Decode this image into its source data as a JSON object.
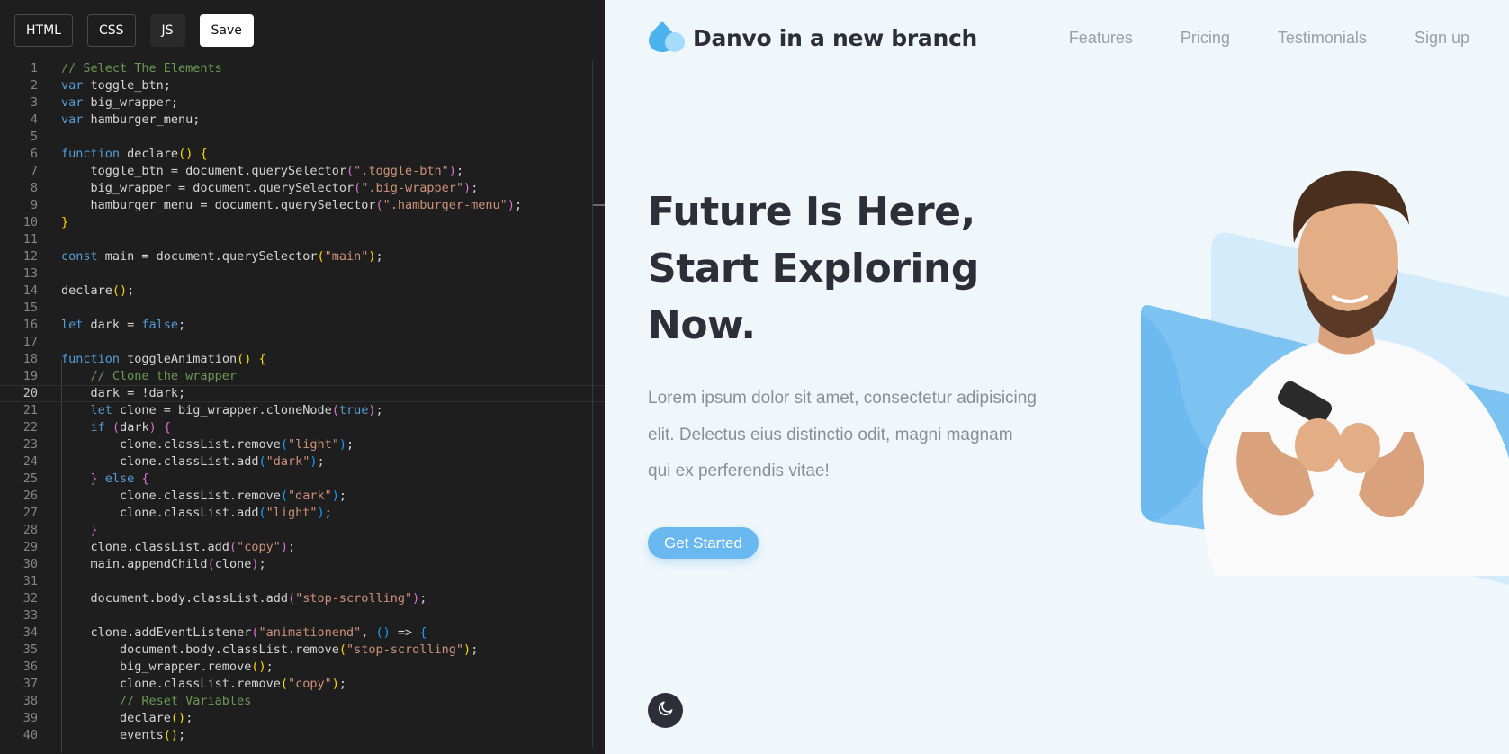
{
  "editor": {
    "tabs": [
      {
        "label": "HTML"
      },
      {
        "label": "CSS"
      },
      {
        "label": "JS"
      }
    ],
    "save_label": "Save",
    "active_tab": "JS",
    "current_line": 20,
    "colors": {
      "keyword": "#569cd6",
      "comment": "#6a9955",
      "string": "#ce9178",
      "bracket_1": "#ffd700",
      "bracket_2": "#da70d6",
      "bracket_3": "#179fff"
    },
    "lines": [
      {
        "n": "1",
        "tokens": [
          [
            "c",
            "// Select The Elements"
          ]
        ]
      },
      {
        "n": "2",
        "tokens": [
          [
            "k",
            "var"
          ],
          [
            "t",
            " toggle_btn;"
          ]
        ]
      },
      {
        "n": "3",
        "tokens": [
          [
            "k",
            "var"
          ],
          [
            "t",
            " big_wrapper;"
          ]
        ]
      },
      {
        "n": "4",
        "tokens": [
          [
            "k",
            "var"
          ],
          [
            "t",
            " hamburger_menu;"
          ]
        ]
      },
      {
        "n": "5",
        "tokens": []
      },
      {
        "n": "6",
        "tokens": [
          [
            "k",
            "function"
          ],
          [
            "t",
            " declare"
          ],
          [
            "p1",
            "()"
          ],
          [
            "t",
            " "
          ],
          [
            "p1",
            "{"
          ]
        ]
      },
      {
        "n": "7",
        "tokens": [
          [
            "t",
            "    toggle_btn = document.querySelector"
          ],
          [
            "p2",
            "("
          ],
          [
            "s",
            "\".toggle-btn\""
          ],
          [
            "p2",
            ")"
          ],
          [
            "t",
            ";"
          ]
        ]
      },
      {
        "n": "8",
        "tokens": [
          [
            "t",
            "    big_wrapper = document.querySelector"
          ],
          [
            "p2",
            "("
          ],
          [
            "s",
            "\".big-wrapper\""
          ],
          [
            "p2",
            ")"
          ],
          [
            "t",
            ";"
          ]
        ]
      },
      {
        "n": "9",
        "tokens": [
          [
            "t",
            "    hamburger_menu = document.querySelector"
          ],
          [
            "p2",
            "("
          ],
          [
            "s",
            "\".hamburger-menu\""
          ],
          [
            "p2",
            ")"
          ],
          [
            "t",
            ";"
          ]
        ]
      },
      {
        "n": "10",
        "tokens": [
          [
            "p1",
            "}"
          ]
        ]
      },
      {
        "n": "11",
        "tokens": []
      },
      {
        "n": "12",
        "tokens": [
          [
            "k",
            "const"
          ],
          [
            "t",
            " main = document.querySelector"
          ],
          [
            "p1",
            "("
          ],
          [
            "s",
            "\"main\""
          ],
          [
            "p1",
            ")"
          ],
          [
            "t",
            ";"
          ]
        ]
      },
      {
        "n": "13",
        "tokens": []
      },
      {
        "n": "14",
        "tokens": [
          [
            "t",
            "declare"
          ],
          [
            "p1",
            "()"
          ],
          [
            "t",
            ";"
          ]
        ]
      },
      {
        "n": "15",
        "tokens": []
      },
      {
        "n": "16",
        "tokens": [
          [
            "k",
            "let"
          ],
          [
            "t",
            " dark = "
          ],
          [
            "k",
            "false"
          ],
          [
            "t",
            ";"
          ]
        ]
      },
      {
        "n": "17",
        "tokens": []
      },
      {
        "n": "18",
        "tokens": [
          [
            "k",
            "function"
          ],
          [
            "t",
            " toggleAnimation"
          ],
          [
            "p1",
            "()"
          ],
          [
            "t",
            " "
          ],
          [
            "p1",
            "{"
          ]
        ]
      },
      {
        "n": "19",
        "tokens": [
          [
            "c",
            "    // Clone the wrapper"
          ]
        ]
      },
      {
        "n": "20",
        "tokens": [
          [
            "t",
            "    dark = !dark;"
          ]
        ]
      },
      {
        "n": "21",
        "tokens": [
          [
            "t",
            "    "
          ],
          [
            "k",
            "let"
          ],
          [
            "t",
            " clone = big_wrapper.cloneNode"
          ],
          [
            "p2",
            "("
          ],
          [
            "k",
            "true"
          ],
          [
            "p2",
            ")"
          ],
          [
            "t",
            ";"
          ]
        ]
      },
      {
        "n": "22",
        "tokens": [
          [
            "t",
            "    "
          ],
          [
            "k",
            "if"
          ],
          [
            "t",
            " "
          ],
          [
            "p2",
            "("
          ],
          [
            "t",
            "dark"
          ],
          [
            "p2",
            ")"
          ],
          [
            "t",
            " "
          ],
          [
            "p2",
            "{"
          ]
        ]
      },
      {
        "n": "23",
        "tokens": [
          [
            "t",
            "        clone.classList.remove"
          ],
          [
            "p3",
            "("
          ],
          [
            "s",
            "\"light\""
          ],
          [
            "p3",
            ")"
          ],
          [
            "t",
            ";"
          ]
        ]
      },
      {
        "n": "24",
        "tokens": [
          [
            "t",
            "        clone.classList.add"
          ],
          [
            "p3",
            "("
          ],
          [
            "s",
            "\"dark\""
          ],
          [
            "p3",
            ")"
          ],
          [
            "t",
            ";"
          ]
        ]
      },
      {
        "n": "25",
        "tokens": [
          [
            "t",
            "    "
          ],
          [
            "p2",
            "}"
          ],
          [
            "t",
            " "
          ],
          [
            "k",
            "else"
          ],
          [
            "t",
            " "
          ],
          [
            "p2",
            "{"
          ]
        ]
      },
      {
        "n": "26",
        "tokens": [
          [
            "t",
            "        clone.classList.remove"
          ],
          [
            "p3",
            "("
          ],
          [
            "s",
            "\"dark\""
          ],
          [
            "p3",
            ")"
          ],
          [
            "t",
            ";"
          ]
        ]
      },
      {
        "n": "27",
        "tokens": [
          [
            "t",
            "        clone.classList.add"
          ],
          [
            "p3",
            "("
          ],
          [
            "s",
            "\"light\""
          ],
          [
            "p3",
            ")"
          ],
          [
            "t",
            ";"
          ]
        ]
      },
      {
        "n": "28",
        "tokens": [
          [
            "t",
            "    "
          ],
          [
            "p2",
            "}"
          ]
        ]
      },
      {
        "n": "29",
        "tokens": [
          [
            "t",
            "    clone.classList.add"
          ],
          [
            "p2",
            "("
          ],
          [
            "s",
            "\"copy\""
          ],
          [
            "p2",
            ")"
          ],
          [
            "t",
            ";"
          ]
        ]
      },
      {
        "n": "30",
        "tokens": [
          [
            "t",
            "    main.appendChild"
          ],
          [
            "p2",
            "("
          ],
          [
            "t",
            "clone"
          ],
          [
            "p2",
            ")"
          ],
          [
            "t",
            ";"
          ]
        ]
      },
      {
        "n": "31",
        "tokens": []
      },
      {
        "n": "32",
        "tokens": [
          [
            "t",
            "    document.body.classList.add"
          ],
          [
            "p2",
            "("
          ],
          [
            "s",
            "\"stop-scrolling\""
          ],
          [
            "p2",
            ")"
          ],
          [
            "t",
            ";"
          ]
        ]
      },
      {
        "n": "33",
        "tokens": []
      },
      {
        "n": "34",
        "tokens": [
          [
            "t",
            "    clone.addEventListener"
          ],
          [
            "p2",
            "("
          ],
          [
            "s",
            "\"animationend\""
          ],
          [
            "t",
            ", "
          ],
          [
            "p3",
            "()"
          ],
          [
            "t",
            " => "
          ],
          [
            "p3",
            "{"
          ]
        ]
      },
      {
        "n": "35",
        "tokens": [
          [
            "t",
            "        document.body.classList.remove"
          ],
          [
            "p1",
            "("
          ],
          [
            "s",
            "\"stop-scrolling\""
          ],
          [
            "p1",
            ")"
          ],
          [
            "t",
            ";"
          ]
        ]
      },
      {
        "n": "36",
        "tokens": [
          [
            "t",
            "        big_wrapper.remove"
          ],
          [
            "p1",
            "()"
          ],
          [
            "t",
            ";"
          ]
        ]
      },
      {
        "n": "37",
        "tokens": [
          [
            "t",
            "        clone.classList.remove"
          ],
          [
            "p1",
            "("
          ],
          [
            "s",
            "\"copy\""
          ],
          [
            "p1",
            ")"
          ],
          [
            "t",
            ";"
          ]
        ]
      },
      {
        "n": "38",
        "tokens": [
          [
            "c",
            "        // Reset Variables"
          ]
        ]
      },
      {
        "n": "39",
        "tokens": [
          [
            "t",
            "        declare"
          ],
          [
            "p1",
            "()"
          ],
          [
            "t",
            ";"
          ]
        ]
      },
      {
        "n": "40",
        "tokens": [
          [
            "t",
            "        events"
          ],
          [
            "p1",
            "()"
          ],
          [
            "t",
            ";"
          ]
        ]
      }
    ]
  },
  "preview": {
    "brand": "Danvo in a new branch",
    "logo_icon": "water-drop-icon",
    "nav": [
      {
        "label": "Features"
      },
      {
        "label": "Pricing"
      },
      {
        "label": "Testimonials"
      },
      {
        "label": "Sign up"
      }
    ],
    "hero": {
      "title_lines": [
        "Future Is Here,",
        "Start Exploring",
        "Now."
      ],
      "text_lines": [
        "Lorem ipsum dolor sit amet, consectetur adipisicing",
        "elit. Delectus eius distinctio odit, magni magnam",
        "qui ex perferendis vitae!"
      ],
      "cta_label": "Get Started"
    },
    "dark_toggle_icon": "moon-icon",
    "hero_image": "man-with-smartphone-illustration",
    "colors": {
      "background": "#f0f7fb",
      "accent": "#6ab8f0",
      "heading": "#2e2e38",
      "muted": "#8a8f96",
      "nav": "#9aa0a6"
    }
  }
}
